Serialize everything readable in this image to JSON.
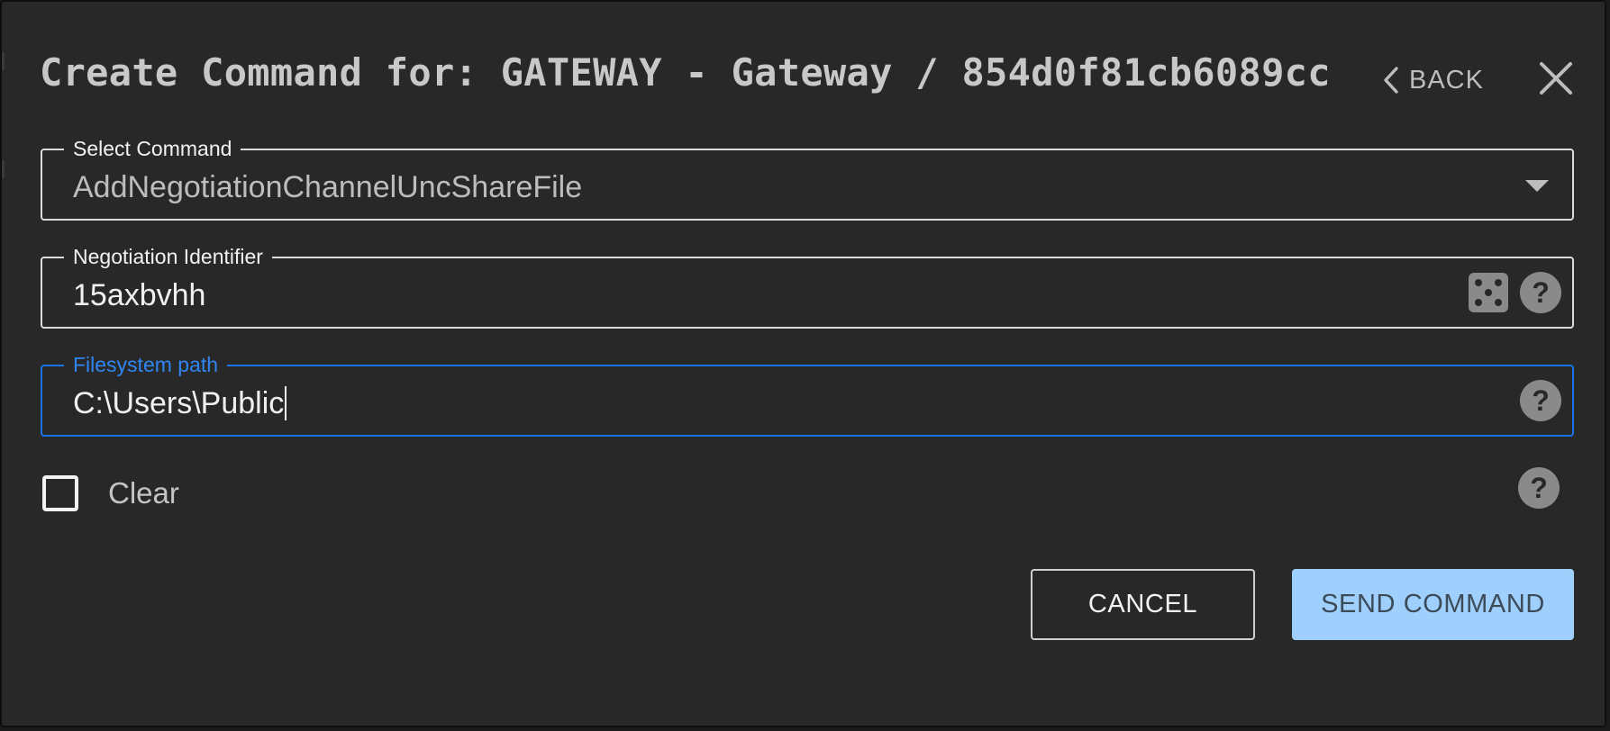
{
  "dialog": {
    "title": "Create Command for: GATEWAY - Gateway / 854d0f81cb6089cc",
    "back_label": "BACK"
  },
  "fields": {
    "command": {
      "label": "Select Command",
      "value": "AddNegotiationChannelUncShareFile"
    },
    "negotiation_identifier": {
      "label": "Negotiation Identifier",
      "value": "15axbvhh"
    },
    "filesystem_path": {
      "label": "Filesystem path",
      "value": "C:\\Users\\Public"
    },
    "clear": {
      "label": "Clear",
      "checked": false
    }
  },
  "actions": {
    "cancel_label": "CANCEL",
    "send_label": "SEND COMMAND"
  },
  "icons": {
    "help": "?"
  },
  "colors": {
    "background": "#282828",
    "focus": "#1a73e8",
    "primary_button": "#9fcffd"
  }
}
